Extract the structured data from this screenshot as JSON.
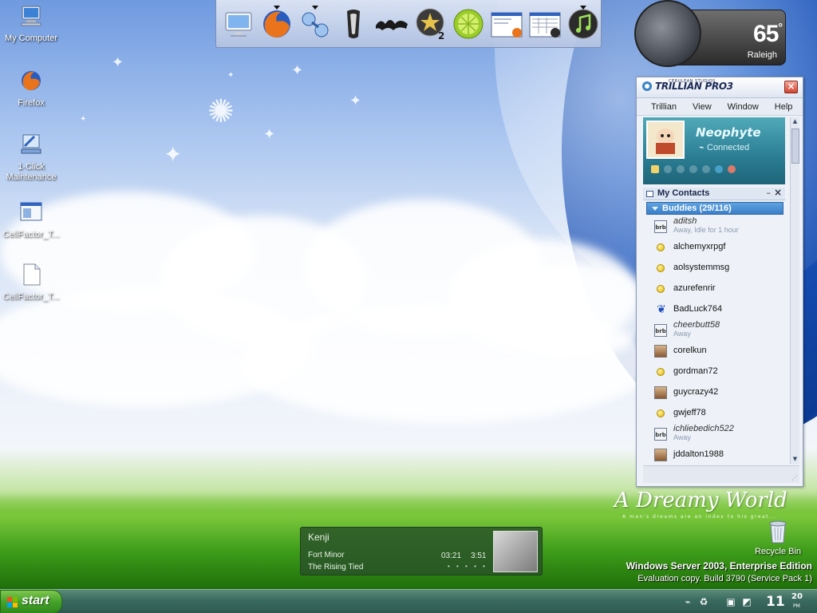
{
  "desktop": {
    "icons": [
      {
        "label": "My Computer"
      },
      {
        "label": "Firefox"
      },
      {
        "label": "1-Click Maintenance"
      },
      {
        "label": "CellFactor_T..."
      },
      {
        "label": "CellFactor_T..."
      }
    ],
    "recycle_bin": {
      "label": "Recycle Bin"
    }
  },
  "dock": {
    "items": [
      {
        "icon": "monitor-icon"
      },
      {
        "icon": "firefox-icon"
      },
      {
        "icon": "network-icon"
      },
      {
        "icon": "oblivion-icon"
      },
      {
        "icon": "graffiti-logo-icon"
      },
      {
        "icon": "star-2-icon"
      },
      {
        "icon": "lime-icon"
      },
      {
        "icon": "window-preview-icon"
      },
      {
        "icon": "spreadsheet-preview-icon"
      },
      {
        "icon": "music-note-icon"
      }
    ]
  },
  "weather": {
    "temperature": "65",
    "degree": "°",
    "city": "Raleigh"
  },
  "trillian": {
    "logo": "TRILLIAN PRO3",
    "logo_small": "CERULEAN STUDIOS",
    "menu": [
      "Trillian",
      "View",
      "Window",
      "Help"
    ],
    "profile": {
      "name": "Neophyte",
      "status": "Connected"
    },
    "contacts_header": "My Contacts",
    "group": "Buddies (29/116)",
    "buddies": [
      {
        "name": "aditsh",
        "status": "Away, Idle for 1 hour",
        "away": true,
        "icon": "brb"
      },
      {
        "name": "alchemyxrpgf",
        "status": "",
        "away": false,
        "icon": "dot"
      },
      {
        "name": "aolsystemmsg",
        "status": "",
        "away": false,
        "icon": "dot"
      },
      {
        "name": "azurefenrir",
        "status": "",
        "away": false,
        "icon": "dot"
      },
      {
        "name": "BadLuck764",
        "status": "",
        "away": false,
        "icon": "butterfly"
      },
      {
        "name": "cheerbutt58",
        "status": "Away",
        "away": true,
        "icon": "brb"
      },
      {
        "name": "corelkun",
        "status": "",
        "away": false,
        "icon": "pic"
      },
      {
        "name": "gordman72",
        "status": "",
        "away": false,
        "icon": "dot"
      },
      {
        "name": "guycrazy42",
        "status": "",
        "away": false,
        "icon": "pic"
      },
      {
        "name": "gwjeff78",
        "status": "",
        "away": false,
        "icon": "dot"
      },
      {
        "name": "ichliebedich522",
        "status": "Away",
        "away": true,
        "icon": "brb"
      },
      {
        "name": "jddalton1988",
        "status": "",
        "away": false,
        "icon": "pic"
      }
    ]
  },
  "brand": {
    "title": "A Dreamy World",
    "motto": "A man's dreams are an index to his great..."
  },
  "os": {
    "edition": "Windows Server 2003, Enterprise Edition",
    "build": "Evaluation copy. Build 3790 (Service Pack 1)"
  },
  "player": {
    "title": "Kenji",
    "artist": "Fort Minor",
    "album": "The Rising Tied",
    "position": "03:21",
    "length": "3:51"
  },
  "taskbar": {
    "start_label": "start",
    "clock_hour": "11",
    "clock_min": "20",
    "clock_ampm": "PM"
  }
}
